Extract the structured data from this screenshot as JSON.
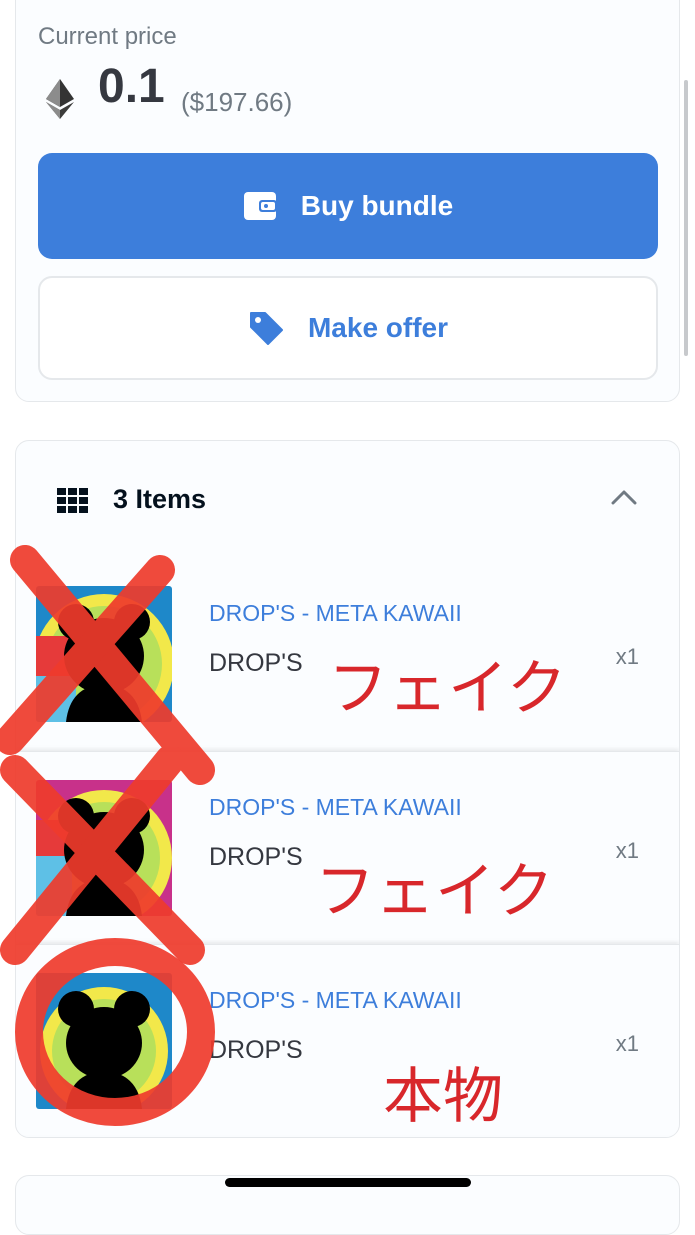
{
  "price": {
    "label": "Current price",
    "value": "0.1",
    "usd": "($197.66)",
    "currency_icon": "ethereum-icon"
  },
  "buttons": {
    "buy": {
      "label": "Buy bundle",
      "icon": "wallet-icon"
    },
    "offer": {
      "label": "Make offer",
      "icon": "tag-icon"
    }
  },
  "items": {
    "title": "3 Items",
    "icon": "grid-icon",
    "toggle_icon": "chevron-up-icon",
    "list": [
      {
        "collection": "DROP'S - META KAWAII",
        "name": "DROP'S",
        "qty": "x1",
        "annotation": "フェイク"
      },
      {
        "collection": "DROP'S - META KAWAII",
        "name": "DROP'S",
        "qty": "x1",
        "annotation": "フェイク"
      },
      {
        "collection": "DROP'S - META KAWAII",
        "name": "DROP'S",
        "qty": "x1",
        "annotation": "本物"
      }
    ]
  },
  "colors": {
    "accent": "#3d7edb",
    "annotation": "#d8272b",
    "text": "#353840",
    "muted": "#707a83"
  }
}
